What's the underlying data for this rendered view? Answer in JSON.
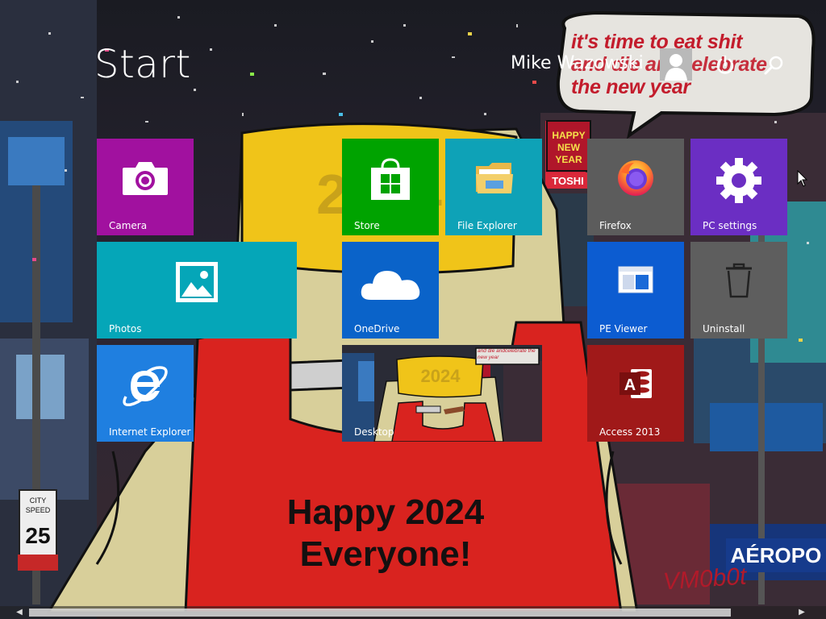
{
  "header": {
    "title": "Start",
    "user_name": "Mike Wazowski",
    "power_icon": "power-icon",
    "search_icon": "search-icon"
  },
  "bubble": {
    "line1": "it's time to eat shit",
    "line2": "and die andcelebrate",
    "line3": "the new year"
  },
  "tiles": [
    {
      "label": "Camera",
      "color": "#a1119f",
      "icon": "camera-icon"
    },
    {
      "label": "Store",
      "color": "#00a300",
      "icon": "store-icon"
    },
    {
      "label": "File Explorer",
      "color": "#0ea2b7",
      "icon": "file-explorer-icon"
    },
    {
      "label": "Firefox",
      "color": "#5c5c5c",
      "icon": "firefox-icon"
    },
    {
      "label": "PC settings",
      "color": "#6b2ec3",
      "icon": "gear-icon"
    },
    {
      "label": "Photos",
      "color": "#05a6b8",
      "icon": "photos-icon"
    },
    {
      "label": "OneDrive",
      "color": "#0a63c9",
      "icon": "cloud-icon"
    },
    {
      "label": "PE Viewer",
      "color": "#0c5cd1",
      "icon": "window-icon"
    },
    {
      "label": "Uninstall",
      "color": "#5e5e5e",
      "icon": "trash-icon"
    },
    {
      "label": "Internet Explorer",
      "color": "#1f7fe0",
      "icon": "internet-explorer-icon"
    },
    {
      "label": "Desktop",
      "color": "#3a3f55",
      "icon": "desktop-thumbnail"
    },
    {
      "label": "Access 2013",
      "color": "#a01919",
      "icon": "access-icon"
    }
  ],
  "drawing": {
    "hat_text": "2024",
    "shirt_line1": "Happy 2024",
    "shirt_line2": "Everyone!",
    "signature": "VM0b0t",
    "sign_city": "CITY",
    "sign_speed": "SPEED",
    "sign_limit": "25",
    "billboard": "HAPPY NEW YEAR",
    "billboard2": "TOSHIBA",
    "store_sign": "AEROPOSTALE"
  },
  "desktop_thumb": {
    "bubble": "and die andcelebrate the new year"
  },
  "scrollbar": {
    "left_arrow": "◀",
    "right_arrow": "▶"
  }
}
